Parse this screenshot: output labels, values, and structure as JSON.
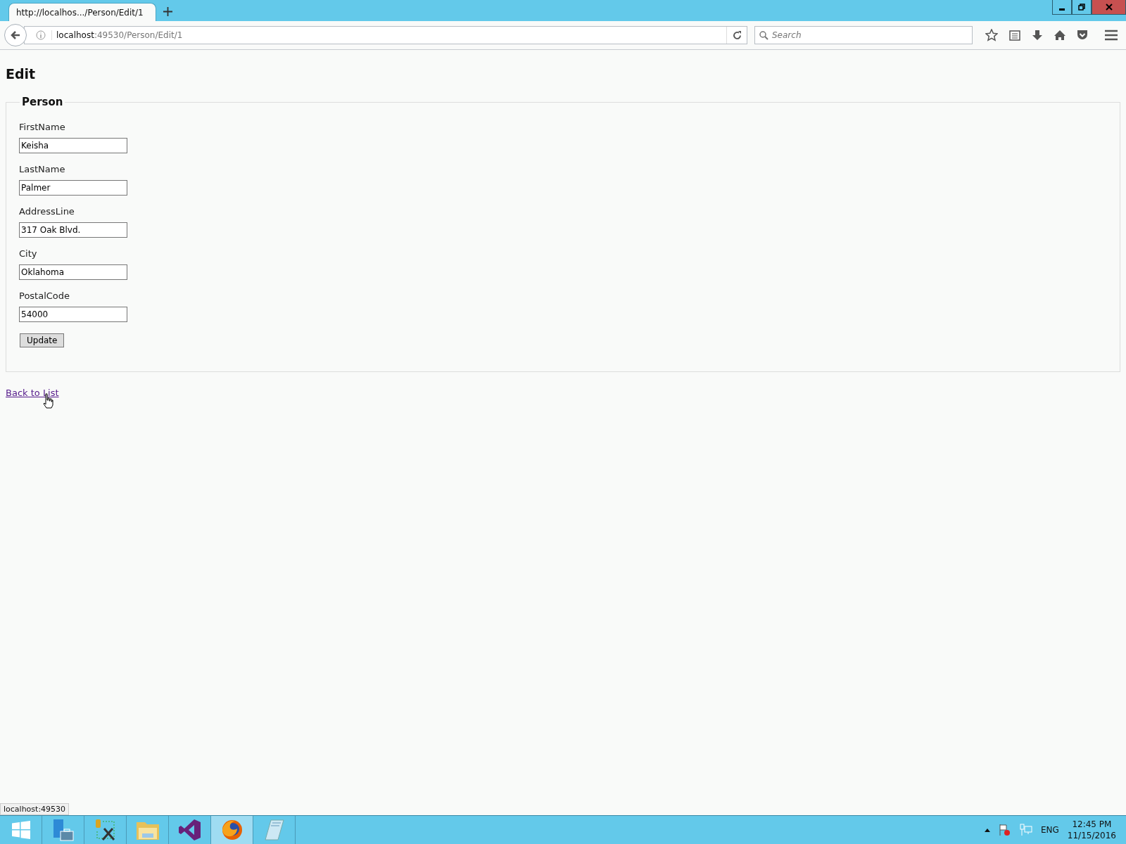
{
  "browser": {
    "tab": {
      "title": "http://localhos.../Person/Edit/1",
      "selected": true
    },
    "address": {
      "host": "localhost",
      "path": ":49530/Person/Edit/1"
    },
    "search": {
      "placeholder": "Search"
    }
  },
  "page": {
    "heading": "Edit",
    "fieldset": {
      "legend": "Person",
      "fields": [
        {
          "label": "FirstName",
          "value": "Keisha"
        },
        {
          "label": "LastName",
          "value": "Palmer"
        },
        {
          "label": "AddressLine",
          "value": "317 Oak Blvd."
        },
        {
          "label": "City",
          "value": "Oklahoma"
        },
        {
          "label": "PostalCode",
          "value": "54000"
        }
      ],
      "submit": "Update"
    },
    "link": "Back to List"
  },
  "status_tooltip": "localhost:49530",
  "taskbar": {
    "apps": [
      {
        "kind": "start",
        "selected": false
      },
      {
        "kind": "server",
        "selected": false
      },
      {
        "kind": "tools",
        "selected": false
      },
      {
        "kind": "folder",
        "selected": false
      },
      {
        "kind": "studio",
        "selected": false
      },
      {
        "kind": "firefox",
        "selected": true
      },
      {
        "kind": "notepad",
        "selected": false
      }
    ],
    "tray": {
      "language": "ENG",
      "time": "12:45 PM",
      "date": "11/15/2016"
    }
  }
}
